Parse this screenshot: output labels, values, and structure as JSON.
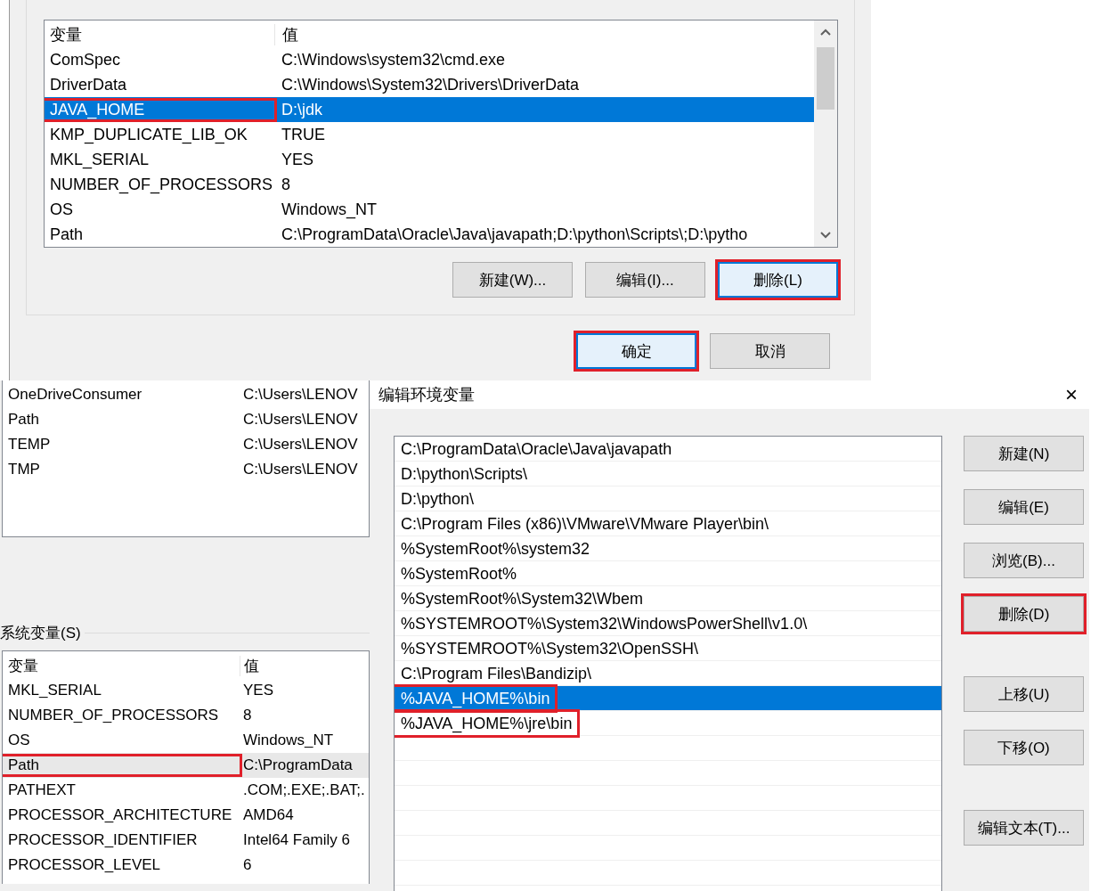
{
  "system_variables_dialog": {
    "columns": [
      "变量",
      "值"
    ],
    "rows": [
      {
        "name": "ComSpec",
        "value": "C:\\Windows\\system32\\cmd.exe",
        "selected": false,
        "highlighted": false
      },
      {
        "name": "DriverData",
        "value": "C:\\Windows\\System32\\Drivers\\DriverData",
        "selected": false,
        "highlighted": false
      },
      {
        "name": "JAVA_HOME",
        "value": "D:\\jdk",
        "selected": true,
        "highlighted": true
      },
      {
        "name": "KMP_DUPLICATE_LIB_OK",
        "value": "TRUE",
        "selected": false,
        "highlighted": false
      },
      {
        "name": "MKL_SERIAL",
        "value": "YES",
        "selected": false,
        "highlighted": false
      },
      {
        "name": "NUMBER_OF_PROCESSORS",
        "value": "8",
        "selected": false,
        "highlighted": false
      },
      {
        "name": "OS",
        "value": "Windows_NT",
        "selected": false,
        "highlighted": false
      },
      {
        "name": "Path",
        "value": "C:\\ProgramData\\Oracle\\Java\\javapath;D:\\python\\Scripts\\;D:\\pytho",
        "selected": false,
        "highlighted": false
      }
    ],
    "buttons": [
      {
        "label": "新建(W)...",
        "focused": false,
        "highlighted": false
      },
      {
        "label": "编辑(I)...",
        "focused": false,
        "highlighted": false
      },
      {
        "label": "删除(L)",
        "focused": true,
        "highlighted": true
      }
    ],
    "footer_buttons": [
      {
        "label": "确定",
        "focused": true,
        "highlighted": true
      },
      {
        "label": "取消",
        "focused": false,
        "highlighted": false
      }
    ]
  },
  "environment_variables_window": {
    "user_rows": [
      {
        "name": "OneDriveConsumer",
        "value": "C:\\Users\\LENOV",
        "selected": false,
        "highlighted": false
      },
      {
        "name": "Path",
        "value": "C:\\Users\\LENOV",
        "selected": false,
        "highlighted": false
      },
      {
        "name": "TEMP",
        "value": "C:\\Users\\LENOV",
        "selected": false,
        "highlighted": false
      },
      {
        "name": "TMP",
        "value": "C:\\Users\\LENOV",
        "selected": false,
        "highlighted": false
      }
    ],
    "system_label": "系统变量(S)",
    "system_columns": [
      "变量",
      "值"
    ],
    "system_rows": [
      {
        "name": "MKL_SERIAL",
        "value": "YES",
        "selected": false,
        "highlighted": false
      },
      {
        "name": "NUMBER_OF_PROCESSORS",
        "value": "8",
        "selected": false,
        "highlighted": false
      },
      {
        "name": "OS",
        "value": "Windows_NT",
        "selected": false,
        "highlighted": false
      },
      {
        "name": "Path",
        "value": "C:\\ProgramData",
        "selected": true,
        "highlighted": true
      },
      {
        "name": "PATHEXT",
        "value": ".COM;.EXE;.BAT;.",
        "selected": false,
        "highlighted": false
      },
      {
        "name": "PROCESSOR_ARCHITECTURE",
        "value": "AMD64",
        "selected": false,
        "highlighted": false
      },
      {
        "name": "PROCESSOR_IDENTIFIER",
        "value": "Intel64 Family 6",
        "selected": false,
        "highlighted": false
      },
      {
        "name": "PROCESSOR_LEVEL",
        "value": "6",
        "selected": false,
        "highlighted": false
      }
    ]
  },
  "edit_dialog": {
    "title": "编辑环境变量",
    "close": "×",
    "entries": [
      {
        "text": "C:\\ProgramData\\Oracle\\Java\\javapath",
        "selected": false,
        "highlighted": false
      },
      {
        "text": "D:\\python\\Scripts\\",
        "selected": false,
        "highlighted": false
      },
      {
        "text": "D:\\python\\",
        "selected": false,
        "highlighted": false
      },
      {
        "text": "C:\\Program Files (x86)\\VMware\\VMware Player\\bin\\",
        "selected": false,
        "highlighted": false
      },
      {
        "text": "%SystemRoot%\\system32",
        "selected": false,
        "highlighted": false
      },
      {
        "text": "%SystemRoot%",
        "selected": false,
        "highlighted": false
      },
      {
        "text": "%SystemRoot%\\System32\\Wbem",
        "selected": false,
        "highlighted": false
      },
      {
        "text": "%SYSTEMROOT%\\System32\\WindowsPowerShell\\v1.0\\",
        "selected": false,
        "highlighted": false
      },
      {
        "text": "%SYSTEMROOT%\\System32\\OpenSSH\\",
        "selected": false,
        "highlighted": false
      },
      {
        "text": "C:\\Program Files\\Bandizip\\",
        "selected": false,
        "highlighted": false
      },
      {
        "text": "%JAVA_HOME%\\bin",
        "selected": true,
        "highlighted": true
      },
      {
        "text": "%JAVA_HOME%\\jre\\bin",
        "selected": false,
        "highlighted": true
      }
    ],
    "button_groups": [
      [
        {
          "label": "新建(N)",
          "highlighted": false
        },
        {
          "label": "编辑(E)",
          "highlighted": false
        },
        {
          "label": "浏览(B)...",
          "highlighted": false
        },
        {
          "label": "删除(D)",
          "highlighted": true
        }
      ],
      [
        {
          "label": "上移(U)",
          "highlighted": false
        },
        {
          "label": "下移(O)",
          "highlighted": false
        }
      ],
      [
        {
          "label": "编辑文本(T)...",
          "highlighted": false
        }
      ]
    ]
  }
}
